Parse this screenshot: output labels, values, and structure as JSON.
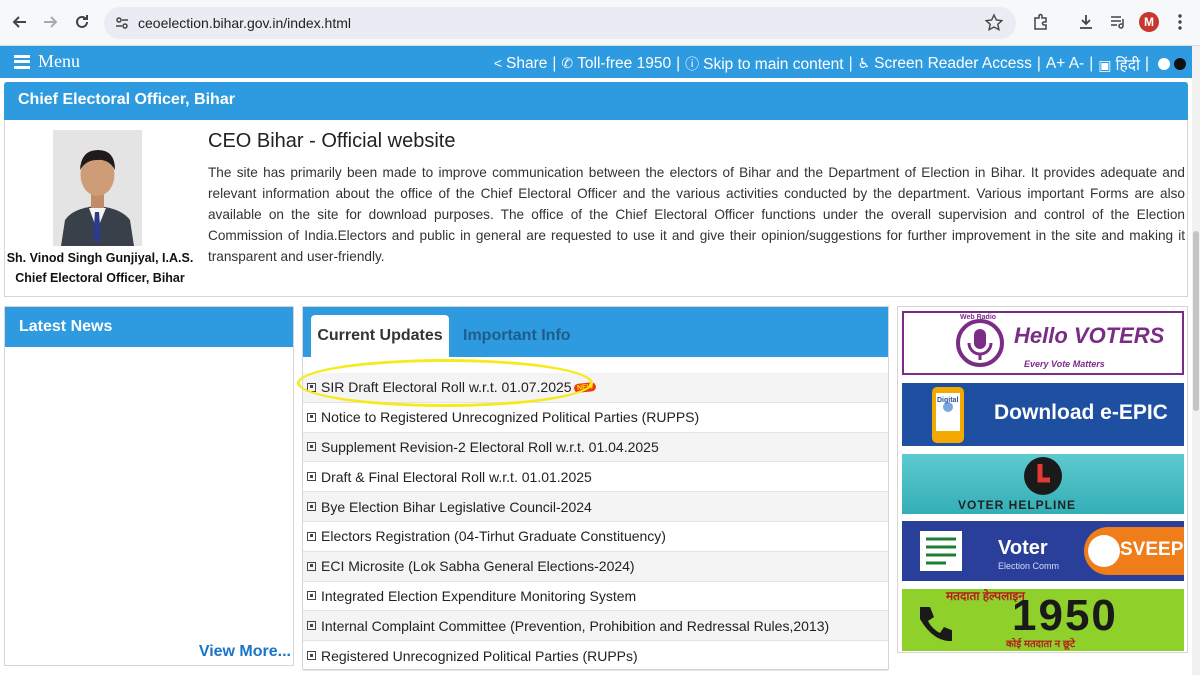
{
  "browser": {
    "url": "ceoelection.bihar.gov.in/index.html",
    "profile_initial": "M"
  },
  "topbar": {
    "menu_label": "Menu",
    "share": "Share",
    "tollfree": "Toll-free 1950",
    "skip": "Skip to main content",
    "screen_reader": "Screen Reader Access",
    "font_size": "A+ A-",
    "hindi": "हिंदी"
  },
  "ceo": {
    "header": "Chief Electoral Officer, Bihar",
    "name": "Sh. Vinod Singh Gunjiyal, I.A.S.",
    "role": "Chief Electoral Officer, Bihar",
    "title": "CEO Bihar - Official website",
    "description": "The site has primarily been made to improve communication between the electors of Bihar and the Department of Election in Bihar. It provides adequate and relevant information about the office of the Chief Electoral Officer and the various activities conducted by the department. Various important Forms are also available on the site for download purposes. The office of the Chief Electoral Officer functions under the overall supervision and control of the Election Commission of India.Electors and public in general are requested to use it and give their opinion/suggestions for further improvement in the site and making it transparent and user-friendly."
  },
  "news": {
    "header": "Latest News",
    "view_more": "View More..."
  },
  "updates": {
    "tabs": [
      "Current Updates",
      "Important Info"
    ],
    "new_badge": "NEW",
    "items": [
      "SIR Draft Electoral Roll w.r.t. 01.07.2025",
      "Notice to Registered Unrecognized Political Parties (RUPPS)",
      "Supplement Revision-2 Electoral Roll w.r.t. 01.04.2025",
      "Draft & Final Electoral Roll w.r.t. 01.01.2025",
      "Bye Election Bihar Legislative Council-2024",
      "Electors Registration (04-Tirhut Graduate Constituency)",
      "ECI Microsite (Lok Sabha General Elections-2024)",
      "Integrated Election Expenditure Monitoring System",
      "Internal Complaint Committee (Prevention, Prohibition and Redressal Rules,2013)",
      "Registered Unrecognized Political Parties (RUPPs)"
    ]
  },
  "banners": {
    "hello_voters_top": "Web Radio",
    "hello_voters": "Hello VOTERS",
    "hello_voters_tag": "Every Vote Matters",
    "epic_badge": "Digital",
    "epic": "Download e-EPIC",
    "helpline": "VOTER HELPLINE",
    "sveep_voter": "Voter",
    "sveep_sub": "Election Comm",
    "sveep": "SVEEP",
    "helpline_hindi": "मतदाता हेल्पलाइन",
    "helpline_number": "1950",
    "helpline_slogan": "कोई मतदाता न छूटे"
  }
}
